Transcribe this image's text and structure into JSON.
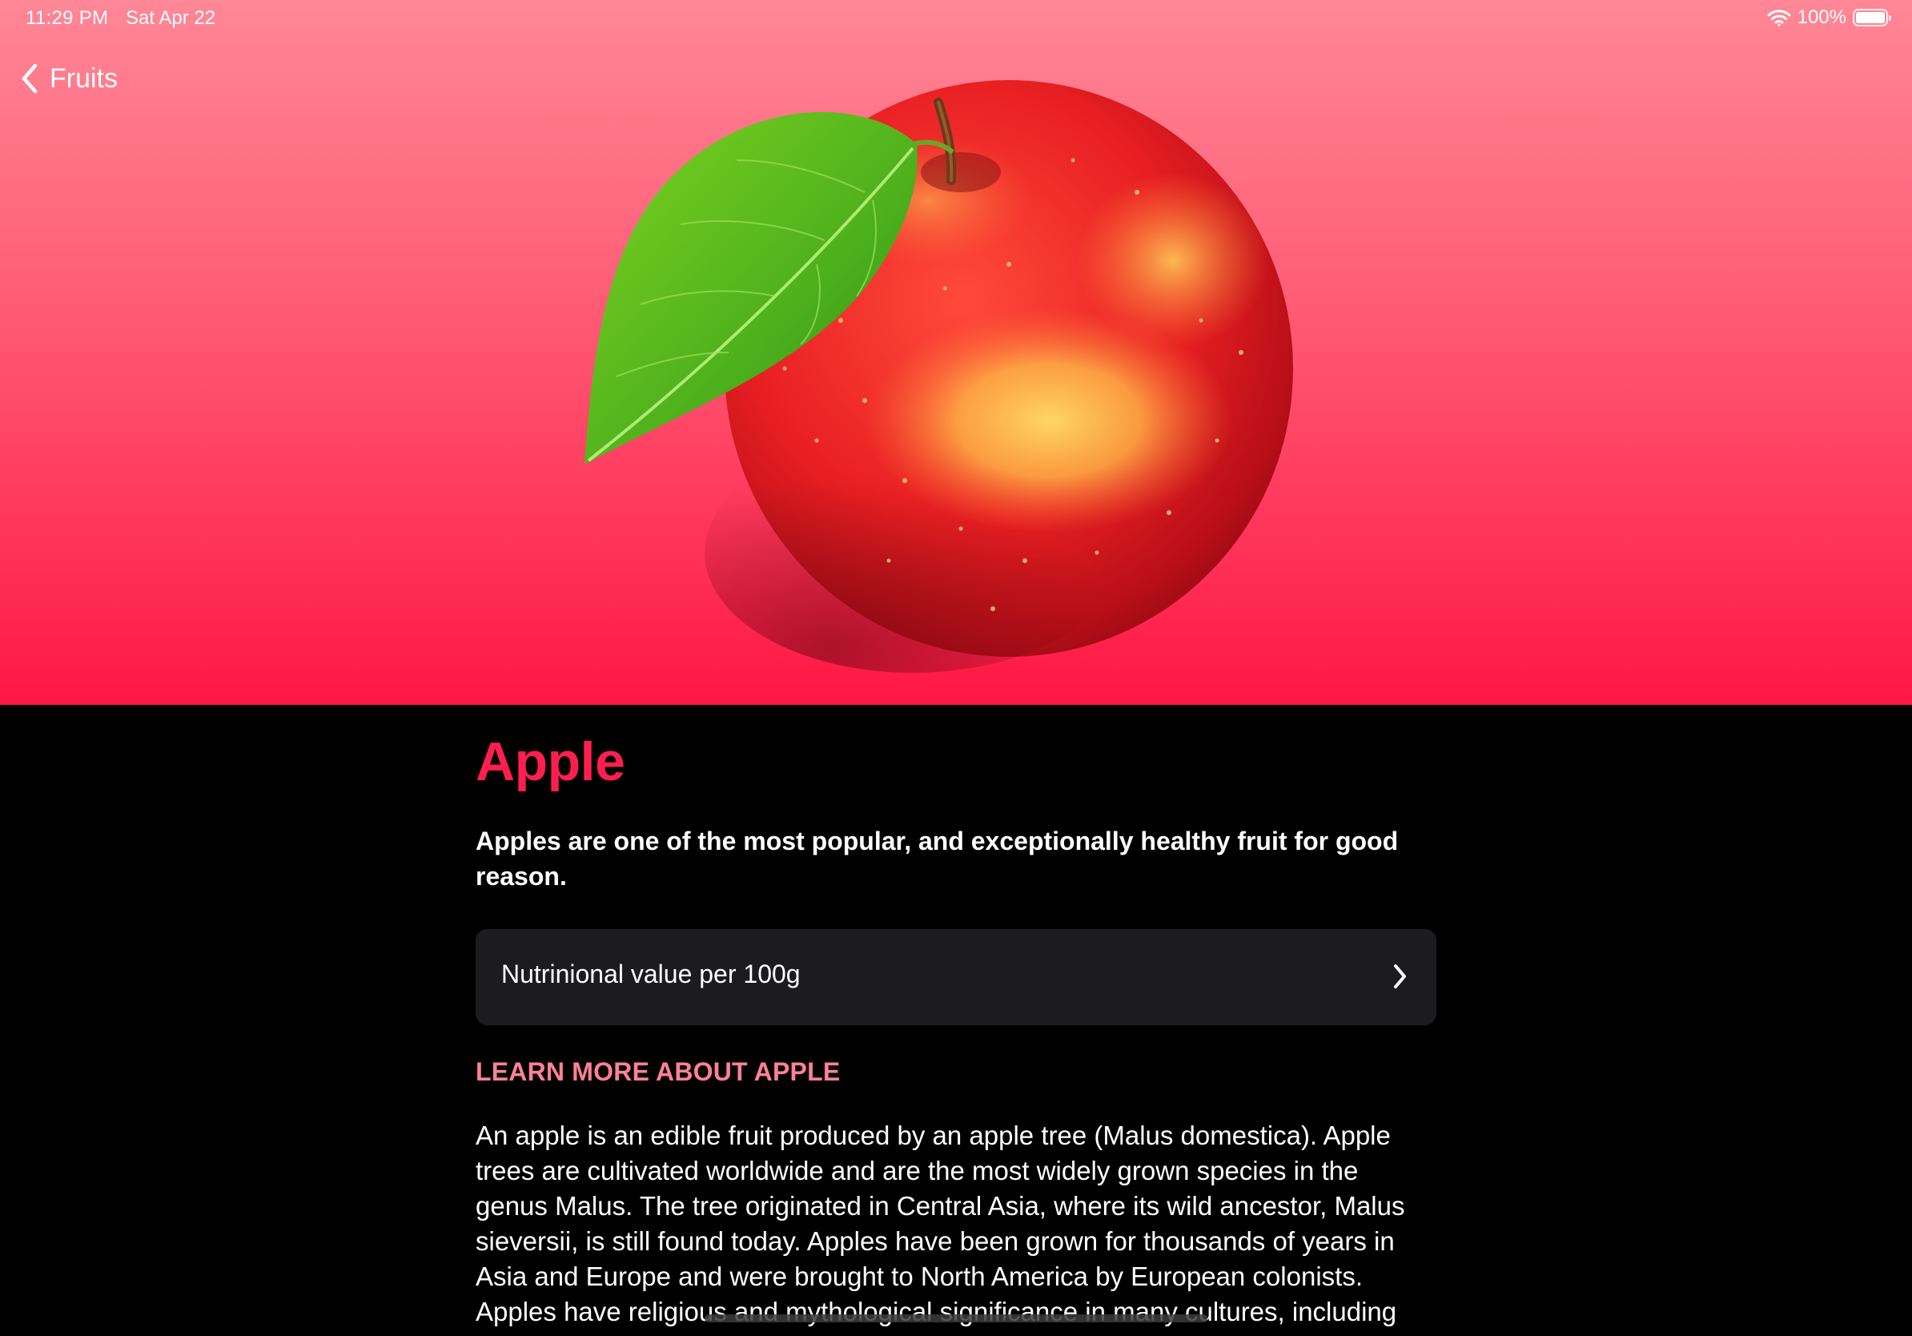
{
  "status_bar": {
    "time": "11:29 PM",
    "date": "Sat Apr 22",
    "battery": "100%",
    "battery_level": 1.0
  },
  "nav": {
    "back_label": "Fruits"
  },
  "fruit": {
    "title": "Apple",
    "headline": "Apples are one of the most popular, and exceptionally healthy fruit for good reason.",
    "nutrition_label": "Nutrinional value per 100g",
    "learn_more": "LEARN MORE ABOUT APPLE",
    "description": "An apple is an edible fruit produced by an apple tree (Malus domestica). Apple trees are cultivated worldwide and are the most widely grown species in the genus Malus. The tree originated in Central Asia, where its wild ancestor, Malus sieversii, is still found today. Apples have been grown for thousands of years in Asia and Europe and were brought to North America by European colonists. Apples have religious and mythological significance in many cultures, including"
  },
  "icons": {
    "back": "chevron-left-icon",
    "row_disclosure": "chevron-right-icon",
    "wifi": "wifi-icon",
    "battery": "battery-icon"
  },
  "colors": {
    "accent": "#ff1f4e",
    "section_header": "#ff8196",
    "hero_top": "#ff8796",
    "hero_bottom": "#ff1744",
    "row_background": "#1c1c1e",
    "background": "#000000"
  }
}
